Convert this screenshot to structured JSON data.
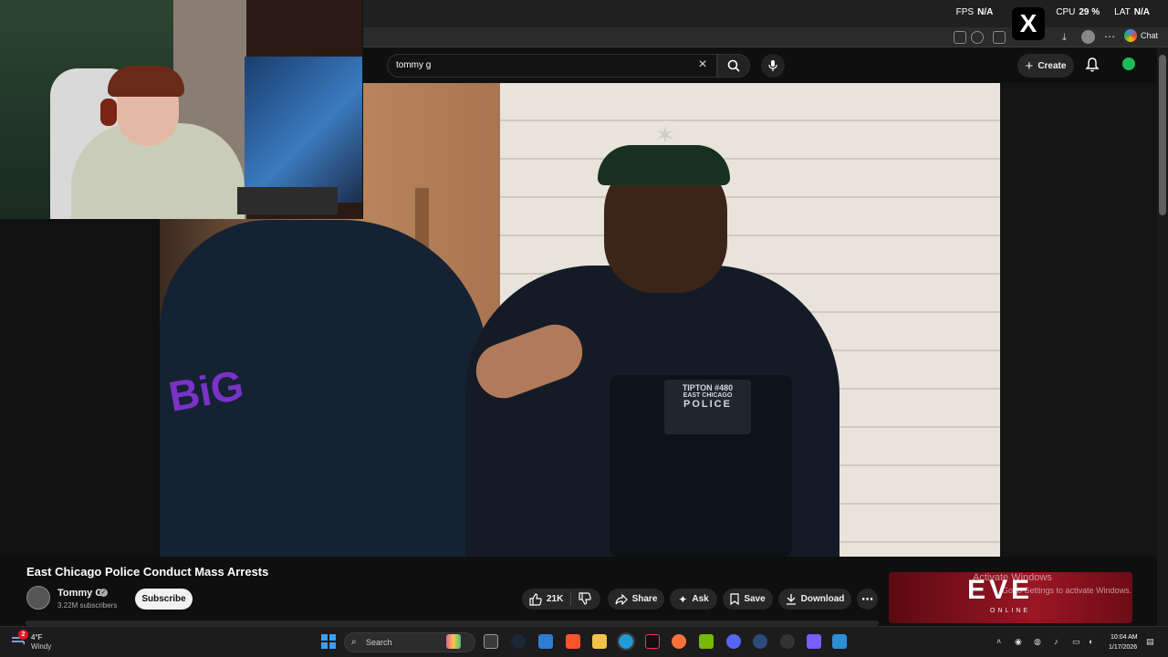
{
  "overlay": {
    "fps_label": "FPS",
    "fps_value": "N/A",
    "cpu_label": "CPU",
    "cpu_value": "29 %",
    "lat_label": "LAT",
    "lat_value": "N/A",
    "partial_value": "%"
  },
  "browser": {
    "chat_label": "Chat"
  },
  "header": {
    "search_value": "tommy g",
    "create_label": "Create"
  },
  "video": {
    "title": "East Chicago Police Conduct Mass Arrests",
    "patch_line1": "TIPTON #480",
    "patch_line2": "EAST CHICAGO",
    "patch_line3": "POLICE"
  },
  "channel": {
    "name": "Tommy G",
    "subscribers": "3.22M subscribers",
    "subscribe_label": "Subscribe"
  },
  "actions": {
    "likes": "21K",
    "share": "Share",
    "ask": "Ask",
    "save": "Save",
    "download": "Download"
  },
  "ad": {
    "brand": "EVE",
    "subtitle": "ONLINE"
  },
  "watermark": {
    "line1": "Activate Windows",
    "line2": "Go to Settings to activate Windows."
  },
  "taskbar": {
    "weather_badge": "2",
    "temperature": "4°F",
    "condition": "Windy",
    "search_placeholder": "Search",
    "time": "10:04 AM",
    "date": "1/17/2026"
  },
  "colors": {
    "accent": "#3ea6ff",
    "ad_red": "#9b1624",
    "windows_blue": "#3aa0f2"
  }
}
